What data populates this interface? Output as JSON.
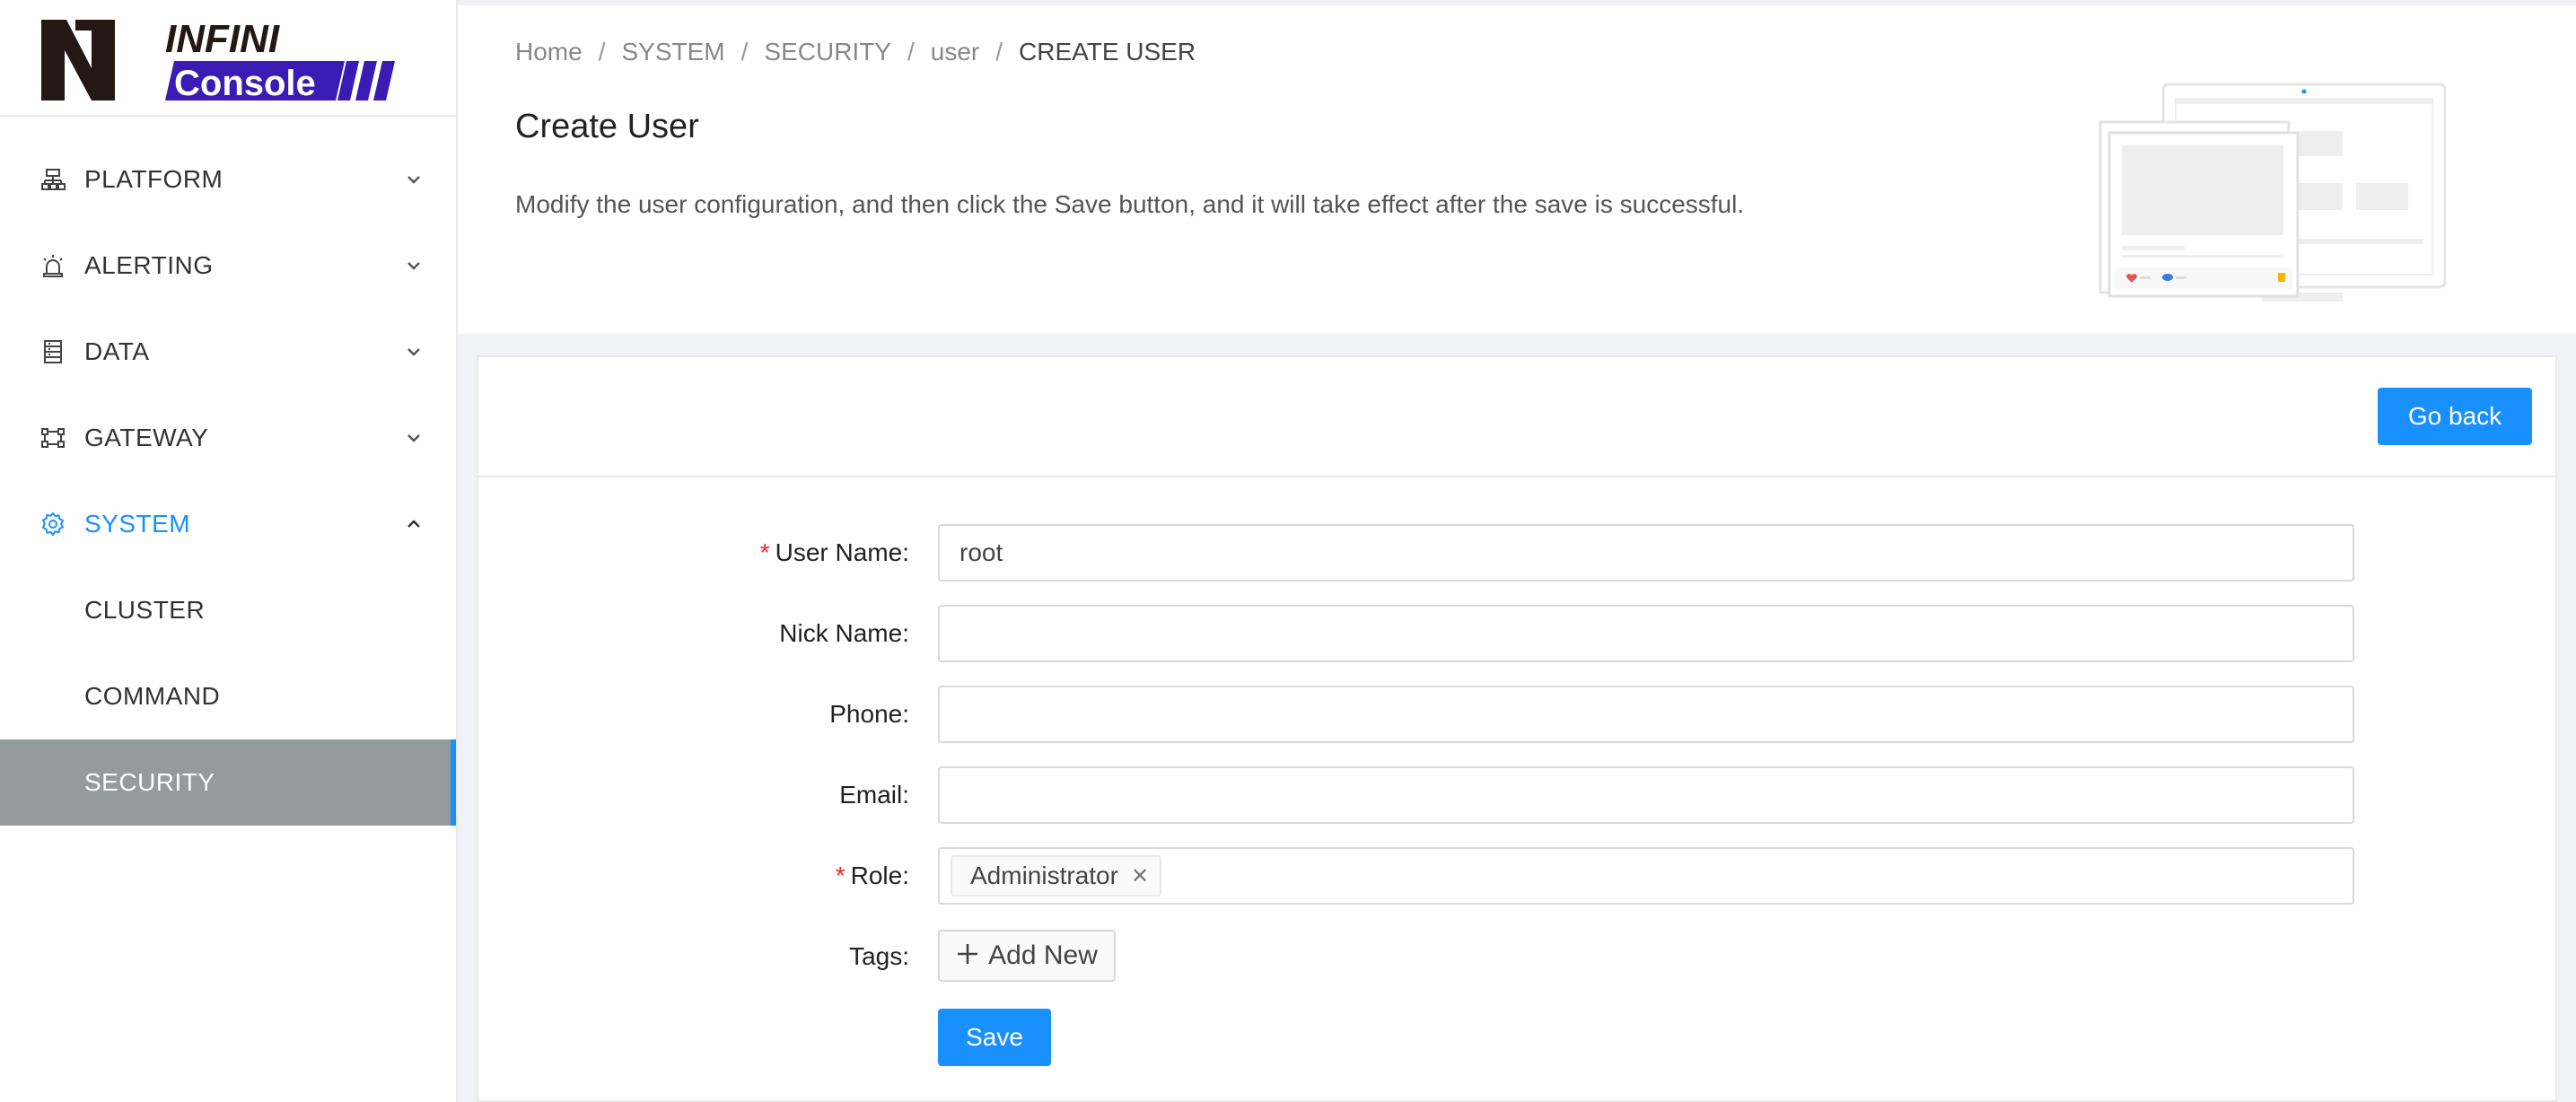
{
  "logo": {
    "line1": "INFINI",
    "line2": "Console",
    "mark": "N"
  },
  "sidebar": {
    "items": [
      {
        "label": "PLATFORM",
        "icon": "cluster-icon"
      },
      {
        "label": "ALERTING",
        "icon": "alarm-icon"
      },
      {
        "label": "DATA",
        "icon": "database-icon"
      },
      {
        "label": "GATEWAY",
        "icon": "gateway-icon"
      },
      {
        "label": "SYSTEM",
        "icon": "gear-icon",
        "expanded": true
      }
    ],
    "sub_items": [
      {
        "label": "CLUSTER"
      },
      {
        "label": "COMMAND"
      },
      {
        "label": "SECURITY",
        "selected": true
      }
    ]
  },
  "breadcrumb": {
    "items": [
      "Home",
      "SYSTEM",
      "SECURITY",
      "user"
    ],
    "current": "CREATE USER",
    "separator": "/"
  },
  "header": {
    "title": "Create User",
    "description": "Modify the user configuration, and then click the Save button, and it will take effect after the save is successful."
  },
  "card": {
    "go_back_label": "Go back"
  },
  "form": {
    "username_label": "User Name",
    "username_value": "root",
    "nickname_label": "Nick Name",
    "nickname_value": "",
    "phone_label": "Phone",
    "phone_value": "",
    "email_label": "Email",
    "email_value": "",
    "role_label": "Role",
    "role_tags": [
      "Administrator"
    ],
    "tags_label": "Tags",
    "add_new_label": "Add New",
    "save_label": "Save",
    "colon": ":",
    "required_mark": "*"
  },
  "colors": {
    "primary": "#1890ff",
    "selected_bg": "#959a9c",
    "required": "#f5222d"
  }
}
